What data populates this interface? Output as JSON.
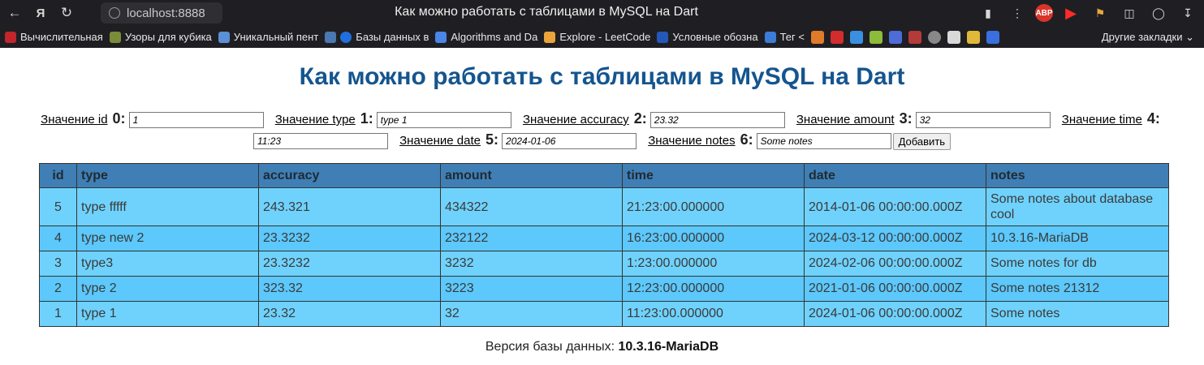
{
  "browser": {
    "url": "localhost:8888",
    "tab_title": "Как можно работать с таблицами в MySQL на Dart",
    "bookmarks": [
      "Вычислительная",
      "Узоры для кубика",
      "Уникальный пент",
      "Базы данных в",
      "Algorithms and Da",
      "Explore - LeetCode",
      "Условные обозна",
      "Тег <"
    ],
    "other_bookmarks": "Другие закладки"
  },
  "page": {
    "title": "Как можно работать с таблицами в MySQL на Dart",
    "form": {
      "fields": [
        {
          "label": "Значение id",
          "num": "0:",
          "value": "1"
        },
        {
          "label": "Значение type",
          "num": "1:",
          "value": "type 1"
        },
        {
          "label": "Значение accuracy",
          "num": "2:",
          "value": "23.32"
        },
        {
          "label": "Значение amount",
          "num": "3:",
          "value": "32"
        },
        {
          "label": "Значение time",
          "num": "4:",
          "value": "11:23"
        },
        {
          "label": "Значение date",
          "num": "5:",
          "value": "2024-01-06"
        },
        {
          "label": "Значение notes",
          "num": "6:",
          "value": "Some notes"
        }
      ],
      "add_button": "Добавить"
    },
    "table": {
      "headers": [
        "id",
        "type",
        "accuracy",
        "amount",
        "time",
        "date",
        "notes"
      ],
      "rows": [
        [
          "5",
          "type fffff",
          "243.321",
          "434322",
          "21:23:00.000000",
          "2014-01-06 00:00:00.000Z",
          "Some notes about database cool"
        ],
        [
          "4",
          "type new 2",
          "23.3232",
          "232122",
          "16:23:00.000000",
          "2024-03-12 00:00:00.000Z",
          "10.3.16-MariaDB"
        ],
        [
          "3",
          "type3",
          "23.3232",
          "3232",
          "1:23:00.000000",
          "2024-02-06 00:00:00.000Z",
          "Some notes for db"
        ],
        [
          "2",
          "type 2",
          "323.32",
          "3223",
          "12:23:00.000000",
          "2021-01-06 00:00:00.000Z",
          "Some notes 21312"
        ],
        [
          "1",
          "type 1",
          "23.32",
          "32",
          "11:23:00.000000",
          "2024-01-06 00:00:00.000Z",
          "Some notes"
        ]
      ]
    },
    "version_label": "Версия базы данных:",
    "version_value": "10.3.16-MariaDB"
  }
}
